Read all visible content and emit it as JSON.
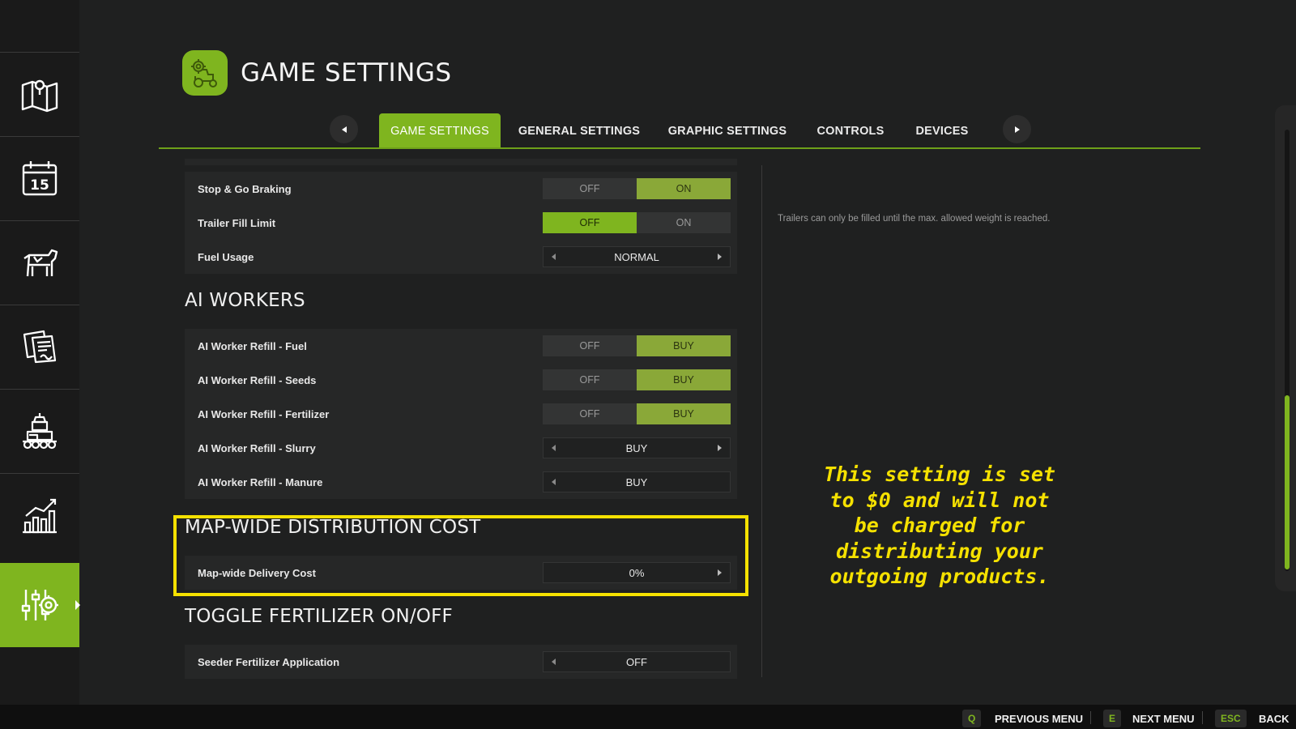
{
  "header": {
    "title": "GAME SETTINGS"
  },
  "tabs": [
    {
      "label": "GAME SETTINGS",
      "active": true
    },
    {
      "label": "GENERAL SETTINGS"
    },
    {
      "label": "GRAPHIC SETTINGS"
    },
    {
      "label": "CONTROLS"
    },
    {
      "label": "DEVICES"
    }
  ],
  "sidebar": {
    "items": [
      {
        "icon": "map-icon"
      },
      {
        "icon": "calendar-icon",
        "text": "15"
      },
      {
        "icon": "cow-icon"
      },
      {
        "icon": "contracts-icon"
      },
      {
        "icon": "production-icon"
      },
      {
        "icon": "statistics-icon"
      },
      {
        "icon": "settings-sliders-icon",
        "active": true
      }
    ]
  },
  "settings": {
    "stop_go_braking": {
      "label": "Stop & Go Braking",
      "off": "OFF",
      "on": "ON",
      "value": "ON"
    },
    "trailer_fill_limit": {
      "label": "Trailer Fill Limit",
      "off": "OFF",
      "on": "ON",
      "value": "OFF"
    },
    "fuel_usage": {
      "label": "Fuel Usage",
      "value": "NORMAL"
    },
    "ai_workers": {
      "title": "AI WORKERS",
      "fuel": {
        "label": "AI Worker Refill - Fuel",
        "off": "OFF",
        "on": "BUY"
      },
      "seeds": {
        "label": "AI Worker Refill - Seeds",
        "off": "OFF",
        "on": "BUY"
      },
      "fertilizer": {
        "label": "AI Worker Refill - Fertilizer",
        "off": "OFF",
        "on": "BUY"
      },
      "slurry": {
        "label": "AI Worker Refill - Slurry",
        "value": "BUY"
      },
      "manure": {
        "label": "AI Worker Refill - Manure",
        "value": "BUY"
      }
    },
    "distribution": {
      "title": "MAP-WIDE DISTRIBUTION COST",
      "delivery_cost": {
        "label": "Map-wide Delivery Cost",
        "value": "0%"
      }
    },
    "fertilizer_toggle": {
      "title": "TOGGLE FERTILIZER ON/OFF",
      "seeder": {
        "label": "Seeder Fertilizer Application",
        "value": "OFF"
      }
    }
  },
  "description": "Trailers can only be filled until the max. allowed weight is reached.",
  "annotation": "This setting is set to $0 and will not be charged for distributing your outgoing products.",
  "footer": {
    "prev": {
      "key": "Q",
      "label": "PREVIOUS MENU"
    },
    "next": {
      "key": "E",
      "label": "NEXT MENU"
    },
    "back": {
      "key": "ESC",
      "label": "BACK"
    }
  },
  "colors": {
    "accent": "#7fb51f",
    "highlight": "#f5e100",
    "background": "#1f2020"
  }
}
